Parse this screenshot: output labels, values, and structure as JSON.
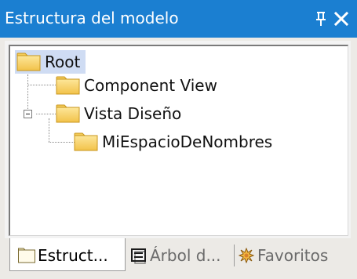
{
  "window": {
    "title": "Estructura del modelo",
    "pin_icon": "pin-icon",
    "close_icon": "close-icon"
  },
  "tree": {
    "nodes": [
      {
        "label": "Root",
        "icon": "folder-icon",
        "selected": true
      },
      {
        "label": "Component View",
        "icon": "folder-icon"
      },
      {
        "label": "Vista Diseño",
        "icon": "folder-icon",
        "expanded": true
      },
      {
        "label": "MiEspacioDeNombres",
        "icon": "folder-icon"
      }
    ]
  },
  "tabs": [
    {
      "label": "Estruct...",
      "icon": "folder-outline-icon",
      "active": true
    },
    {
      "label": "Árbol d...",
      "icon": "diagram-tree-icon",
      "active": false
    },
    {
      "label": "Favoritos",
      "icon": "star-burst-icon",
      "active": false
    }
  ],
  "colors": {
    "titlebar": "#1b7fd1",
    "folder": "#f7d36a",
    "selection": "#cfdcf3"
  }
}
